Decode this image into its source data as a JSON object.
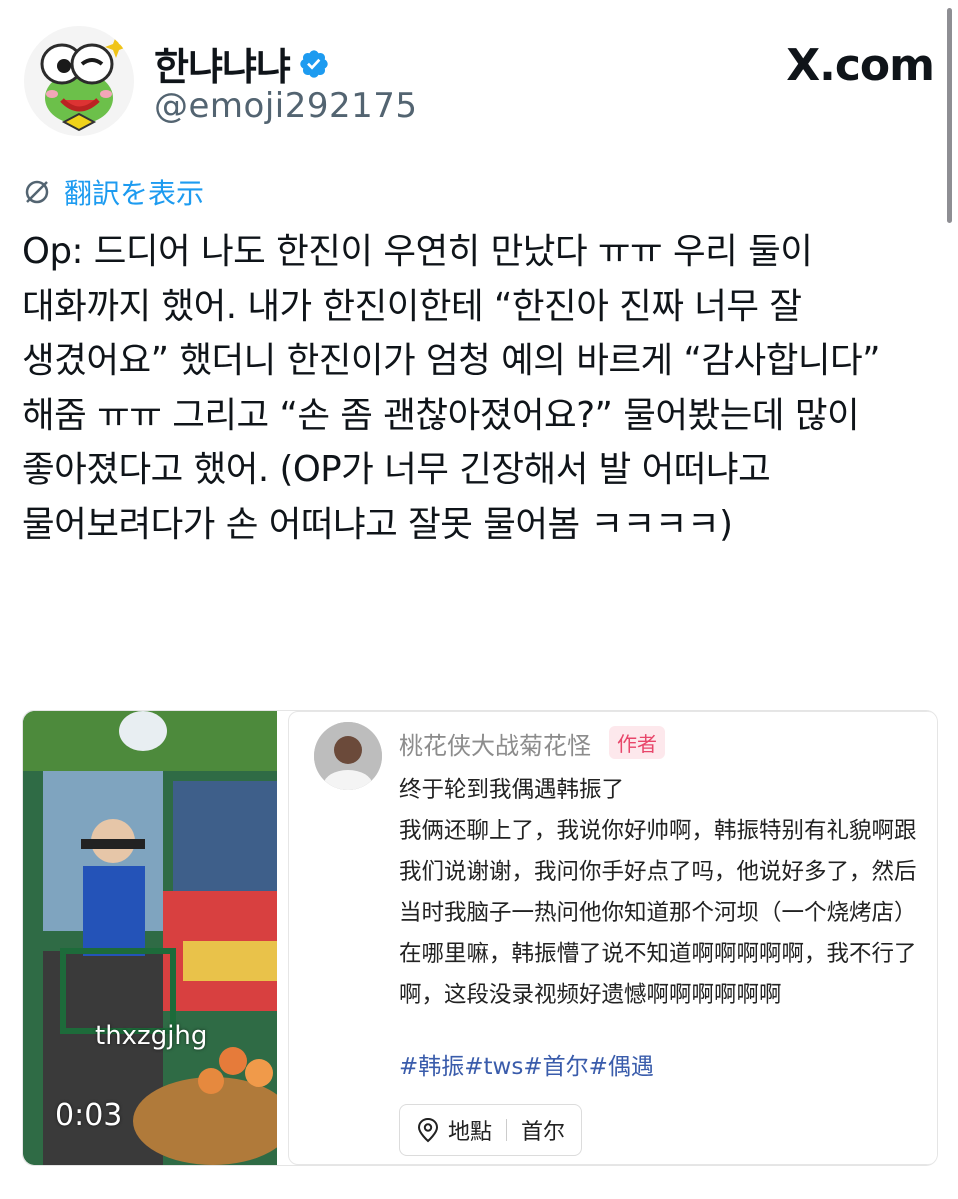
{
  "user": {
    "display_name": "한냐냐냐",
    "handle": "@emoji292175",
    "site": "X.com"
  },
  "translate": {
    "label": "翻訳を表示"
  },
  "tweet": {
    "text": "Op: 드디어 나도 한진이 우연히 만났다 ㅠㅠ 우리 둘이 대화까지 했어. 내가 한진이한테 “한진아 진짜 너무 잘 생겼어요” 했더니 한진이가 엄청 예의 바르게 “감사합니다” 해줌 ㅠㅠ 그리고 “손 좀 괜찮아졌어요?” 물어봤는데 많이 좋아졌다고 했어. (OP가 너무 긴장해서 발 어떠냐고 물어보려다가 손 어떠냐고 잘못 물어봄 ㅋㅋㅋㅋ)"
  },
  "media": {
    "video": {
      "watermark": "thxzgjhg",
      "duration": "0:03"
    },
    "post": {
      "author": "桃花侠大战菊花怪",
      "badge": "作者",
      "text": "终于轮到我偶遇韩振了\n我俩还聊上了，我说你好帅啊，韩振特别有礼貌啊跟我们说谢谢，我问你手好点了吗，他说好多了，然后当时我脑子一热问他你知道那个河坝（一个烧烤店）在哪里嘛，韩振懵了说不知道啊啊啊啊啊，我不行了啊，这段没录视频好遗憾啊啊啊啊啊啊",
      "tags": "#韩振#tws#首尔#偶遇",
      "location_label": "地點",
      "location_value": "首尔"
    }
  },
  "colors": {
    "link": "#1d9bf0",
    "verified": "#1d9bf0",
    "text": "#0f1419",
    "secondary": "#536471",
    "author_badge": "#e8466a",
    "tag": "#3a5cab"
  }
}
